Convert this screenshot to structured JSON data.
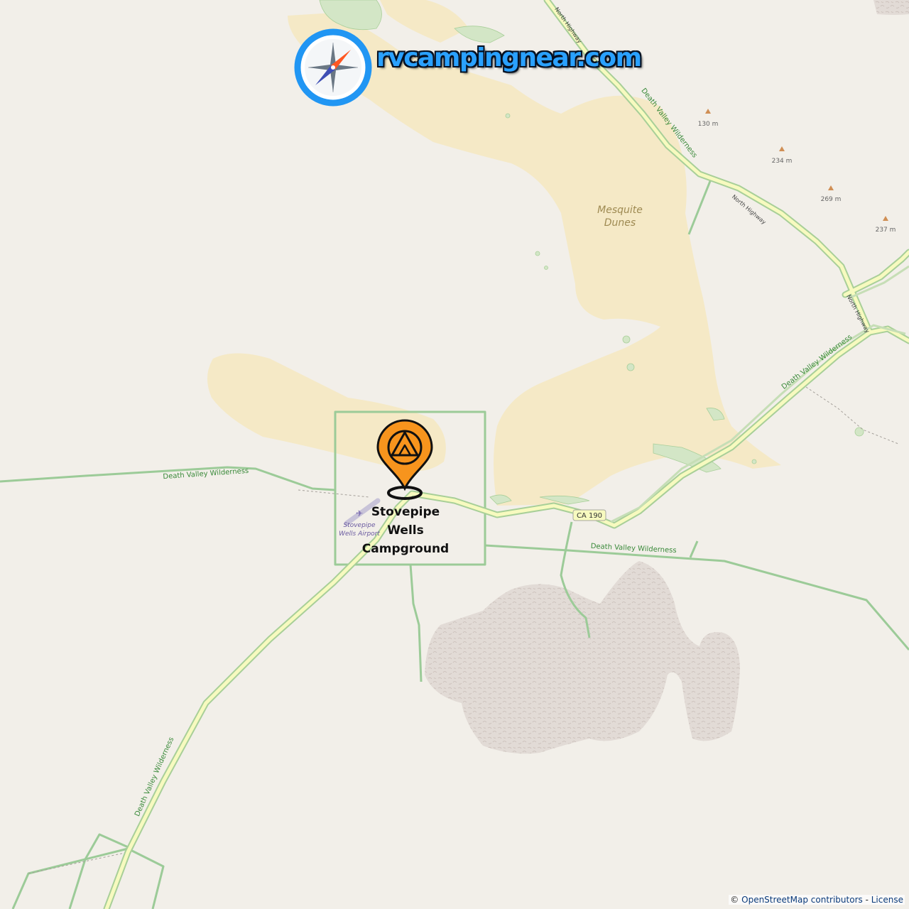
{
  "brand": {
    "name": "rvcampingnear.com",
    "icon": "compass-icon"
  },
  "marker": {
    "icon": "tent-pin-icon",
    "label_lines": [
      "Stovepipe",
      "Wells",
      "Campground"
    ],
    "color": "#f7941d"
  },
  "map_labels": {
    "dunes": [
      "Mesquite",
      "Dunes"
    ],
    "airport": [
      "Stovepipe",
      "Wells Airport"
    ],
    "road_ref": "CA 190",
    "wilderness": "Death Valley Wilderness",
    "highway": "North Highway",
    "peaks": [
      "130 m",
      "234 m",
      "269 m",
      "237 m"
    ]
  },
  "attribution": {
    "prefix": "©",
    "text": "OpenStreetMap contributors",
    "separator": "-",
    "license": "License"
  },
  "colors": {
    "land": "#f2efe9",
    "sand": "#f5e9c6",
    "road_fill": "#f7fabf",
    "road_casing": "#b9d7a9",
    "wilderness_line": "#9ccb98",
    "rock": "#ddd6d2",
    "brand_blue": "#2aa1ff"
  }
}
